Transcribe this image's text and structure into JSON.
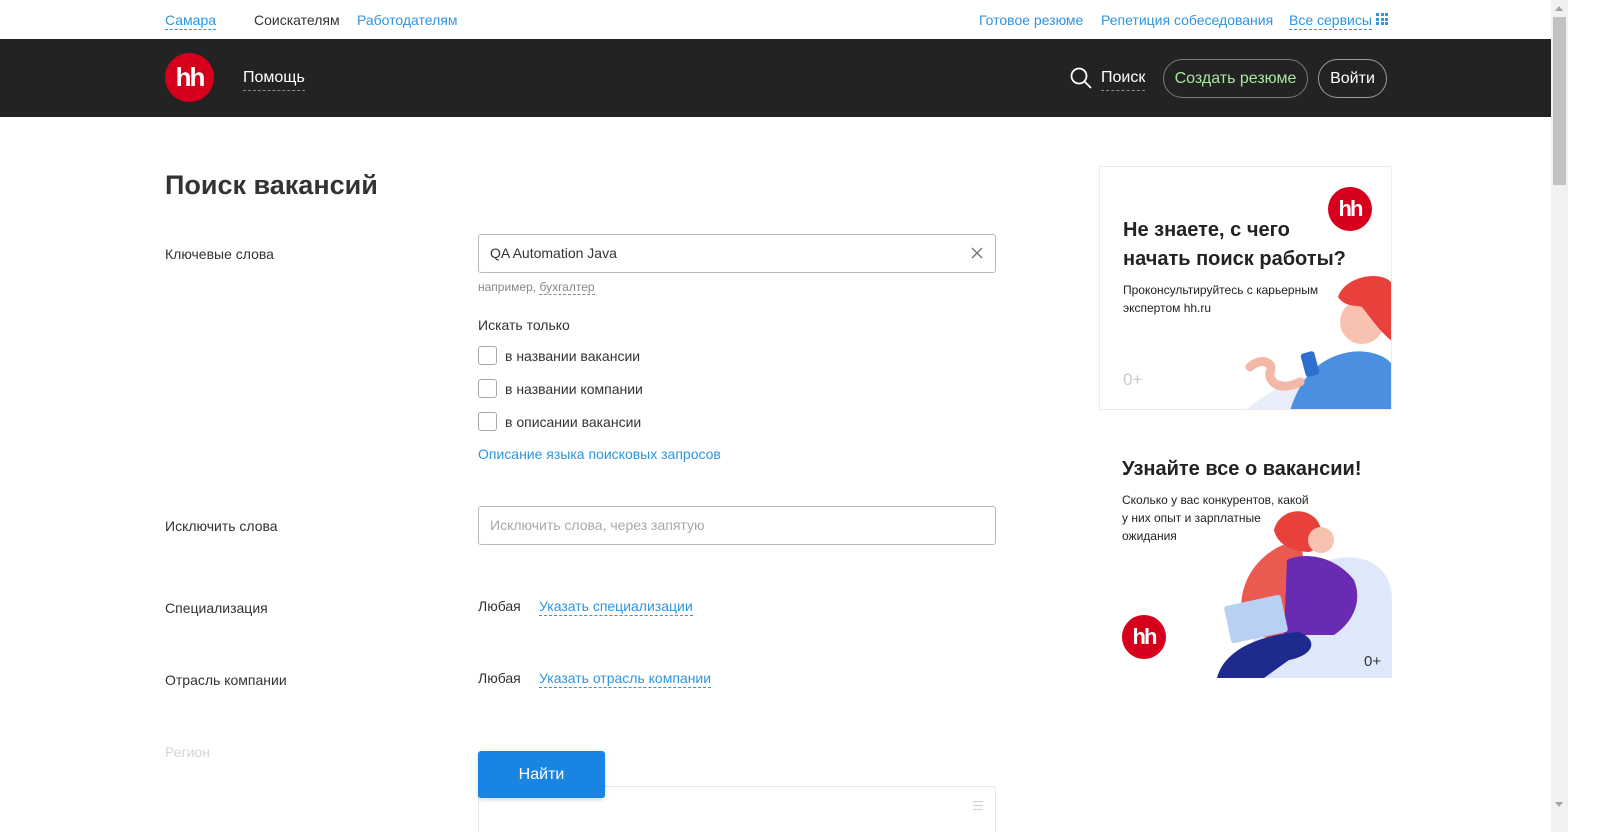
{
  "topbar": {
    "city": "Самара",
    "seekers": "Соискателям",
    "employers": "Работодателям",
    "ready_resume": "Готовое резюме",
    "interview_rehearsal": "Репетиция собеседования",
    "all_services": "Все сервисы"
  },
  "header": {
    "logo": "hh",
    "help": "Помощь",
    "search": "Поиск",
    "create_resume": "Создать резюме",
    "login": "Войти"
  },
  "main": {
    "title": "Поиск вакансий",
    "keywords": {
      "label": "Ключевые слова",
      "value": "QA Automation Java",
      "hint_prefix": "например,",
      "hint_example": "бухгалтер"
    },
    "search_only": {
      "label": "Искать только",
      "options": [
        "в названии вакансии",
        "в названии компании",
        "в описании вакансии"
      ]
    },
    "query_language_link": "Описание языка поисковых запросов",
    "exclude": {
      "label": "Исключить слова",
      "placeholder": "Исключить слова, через запятую"
    },
    "specialization": {
      "label": "Специализация",
      "value": "Любая",
      "link": "Указать специализации"
    },
    "industry": {
      "label": "Отрасль компании",
      "value": "Любая",
      "link": "Указать отрасль компании"
    },
    "region": {
      "label": "Регион"
    },
    "find_button": "Найти"
  },
  "banners": [
    {
      "title_line1": "Не знаете, с чего",
      "title_line2": "начать поиск работы?",
      "sub_line1": "Проконсультируйтесь с карьерным",
      "sub_line2": "экспертом hh.ru",
      "age": "0+",
      "logo": "hh"
    },
    {
      "title": "Узнайте все о вакансии!",
      "sub_line1": "Сколько у вас конкурентов, какой",
      "sub_line2": "у них опыт и зарплатные",
      "sub_line3": "ожидания",
      "age": "0+",
      "logo": "hh"
    }
  ],
  "colors": {
    "link_blue": "#2f95e0",
    "header_dark": "#232323",
    "brand_red": "#d6001c",
    "button_blue": "#1a84e2",
    "create_resume_green": "#a9e5a0"
  },
  "icons": [
    "grid-icon",
    "search-icon",
    "clear-icon",
    "scroll-arrow-up-icon",
    "scroll-arrow-down-icon",
    "list-lines-icon"
  ]
}
